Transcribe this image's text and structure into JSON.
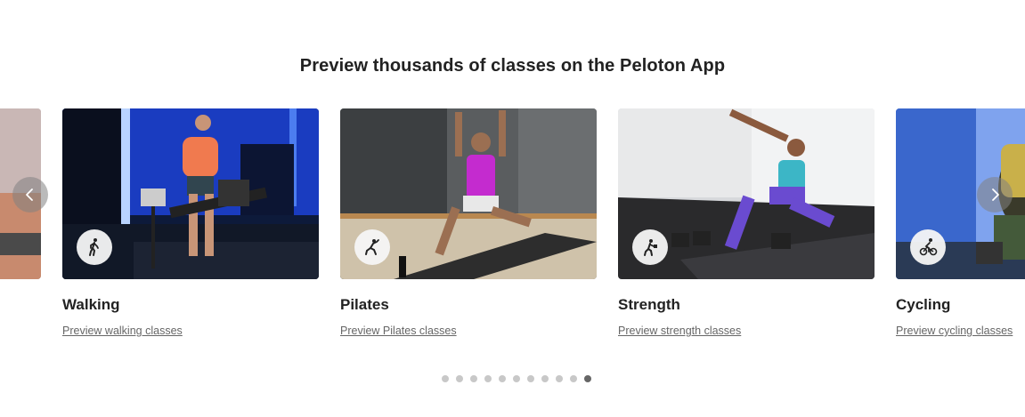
{
  "heading": "Preview thousands of classes on the Peloton App",
  "cards": [
    {
      "title": "",
      "link": "",
      "icon": "partial-card-image"
    },
    {
      "title": "Walking",
      "link": "Preview walking classes",
      "icon": "walking-icon"
    },
    {
      "title": "Pilates",
      "link": "Preview Pilates classes",
      "icon": "pilates-icon"
    },
    {
      "title": "Strength",
      "link": "Preview strength classes",
      "icon": "strength-icon"
    },
    {
      "title": "Cycling",
      "link": "Preview cycling classes",
      "icon": "cycling-icon"
    }
  ],
  "carousel": {
    "prev_icon": "chevron-left-icon",
    "next_icon": "chevron-right-icon",
    "dot_count": 11,
    "active_dot": 11
  }
}
